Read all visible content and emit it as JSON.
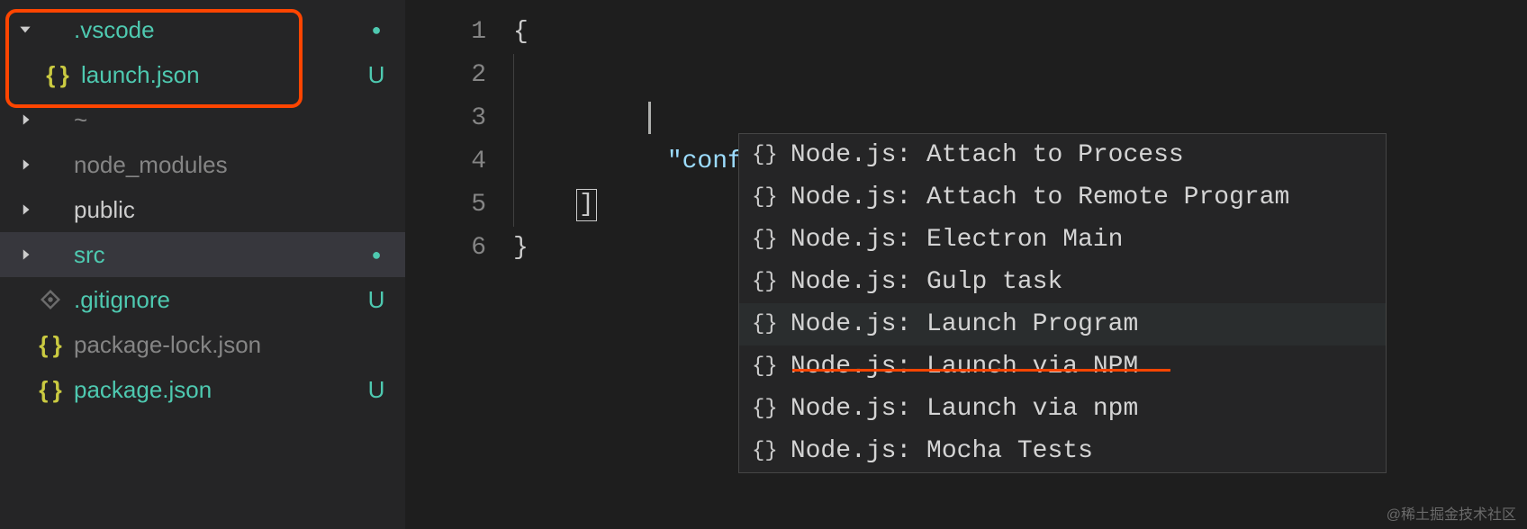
{
  "sidebar": {
    "items": [
      {
        "label": ".vscode",
        "type": "folder",
        "expanded": true,
        "modified": true,
        "status": "●",
        "indent": 0
      },
      {
        "label": "launch.json",
        "type": "json-file",
        "modified": true,
        "status": "U",
        "indent": 1
      },
      {
        "label": "~",
        "type": "folder",
        "expanded": false,
        "dim": true,
        "indent": 0
      },
      {
        "label": "node_modules",
        "type": "folder",
        "expanded": false,
        "dim": true,
        "indent": 0
      },
      {
        "label": "public",
        "type": "folder",
        "expanded": false,
        "indent": 0
      },
      {
        "label": "src",
        "type": "folder",
        "expanded": false,
        "modified": true,
        "status": "●",
        "selected": true,
        "indent": 0
      },
      {
        "label": ".gitignore",
        "type": "git-file",
        "modified": true,
        "status": "U",
        "indent": 0
      },
      {
        "label": "package-lock.json",
        "type": "json-file",
        "dim": true,
        "indent": 0
      },
      {
        "label": "package.json",
        "type": "json-file",
        "modified": true,
        "status": "U",
        "indent": 0
      }
    ]
  },
  "editor": {
    "lineNumbers": [
      "1",
      "2",
      "3",
      "4",
      "5",
      "6"
    ],
    "code": {
      "l1": "{",
      "l2_key": "\"configurations\"",
      "l2_colon": ": ",
      "l2_bracket": "[",
      "l5_bracket": "]",
      "l6": "}"
    }
  },
  "suggestions": [
    {
      "label": "Node.js: Attach to Process"
    },
    {
      "label": "Node.js: Attach to Remote Program"
    },
    {
      "label": "Node.js: Electron Main"
    },
    {
      "label": "Node.js: Gulp task"
    },
    {
      "label": "Node.js: Launch Program",
      "highlighted": true
    },
    {
      "label": "Node.js: Launch via NPM"
    },
    {
      "label": "Node.js: Launch via npm"
    },
    {
      "label": "Node.js: Mocha Tests"
    }
  ],
  "watermark": "@稀土掘金技术社区"
}
